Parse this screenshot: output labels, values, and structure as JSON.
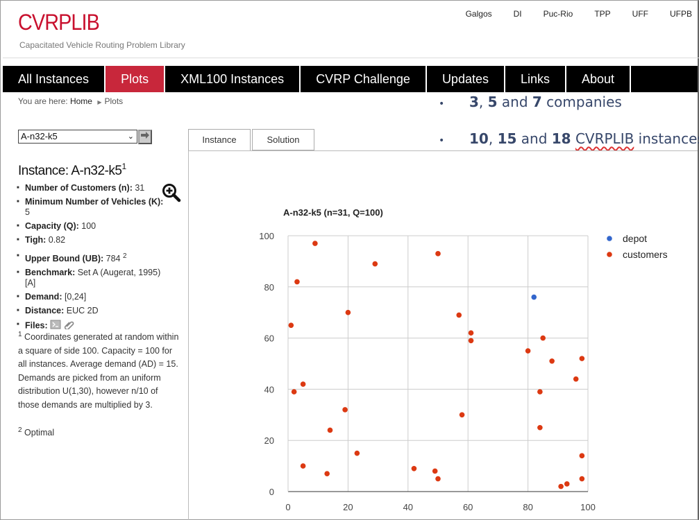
{
  "site": {
    "logo": "CVRPLIB",
    "tagline": "Capacitated Vehicle Routing Problem Library"
  },
  "top_links": [
    "Galgos",
    "DI",
    "Puc-Rio",
    "TPP",
    "UFF",
    "UFPB"
  ],
  "nav": [
    {
      "label": "All Instances",
      "active": false
    },
    {
      "label": "Plots",
      "active": true
    },
    {
      "label": "XML100 Instances",
      "active": false
    },
    {
      "label": "CVRP Challenge",
      "active": false
    },
    {
      "label": "Updates",
      "active": false
    },
    {
      "label": "Links",
      "active": false
    },
    {
      "label": "About",
      "active": false
    }
  ],
  "breadcrumb": {
    "prefix": "You are here:",
    "home": "Home",
    "current": "Plots"
  },
  "overlay": {
    "line1": {
      "n1": "3",
      "sep1": ", ",
      "n2": "5",
      "mid": " and ",
      "n3": "7",
      "tail": " companies"
    },
    "line2": {
      "n1": "10",
      "sep1": ", ",
      "n2": "15",
      "mid": " and ",
      "n3": "18",
      "word": "CVRPLIB",
      "tail": " instances"
    }
  },
  "selector": {
    "value": "A-n32-k5"
  },
  "instance": {
    "title": "Instance: A-n32-k5",
    "title_sup": "1",
    "props": [
      {
        "label": "Number of Customers (n):",
        "value": " 31"
      },
      {
        "label": "Minimum Number of Vehicles (K):",
        "value": " 5"
      },
      {
        "label": "Capacity (Q):",
        "value": " 100"
      },
      {
        "label": "Tigh:",
        "value": " 0.82"
      },
      {
        "label": "Upper Bound (UB):",
        "value": " 784",
        "sup": "2"
      },
      {
        "label": "Benchmark:",
        "value": " Set A (Augerat, 1995) [A]"
      },
      {
        "label": "Demand:",
        "value": " [0,24]"
      },
      {
        "label": "Distance:",
        "value": " EUC 2D"
      },
      {
        "label": "Files:",
        "value": ""
      }
    ]
  },
  "notes": {
    "n1_sup": "1",
    "n1": " Coordinates generated at random within a square of side 100. Capacity = 100 for all instances. Average demand (AD) = 15. Demands are picked from an uniform distribution U(1,30), however n/10 of those demands are multiplied by 3.",
    "n2_sup": "2",
    "n2": " Optimal"
  },
  "tabs": [
    "Instance",
    "Solution"
  ],
  "colors": {
    "brand": "#c8102e",
    "depot": "#3366cc",
    "customers": "#dc3912"
  },
  "chart_data": {
    "type": "scatter",
    "title": "A-n32-k5 (n=31, Q=100)",
    "xlabel": "",
    "ylabel": "",
    "xlim": [
      0,
      100
    ],
    "ylim": [
      0,
      100
    ],
    "xticks": [
      0,
      20,
      40,
      60,
      80,
      100
    ],
    "yticks": [
      0,
      20,
      40,
      60,
      80,
      100
    ],
    "grid": true,
    "legend": "right",
    "series": [
      {
        "name": "depot",
        "color": "#3366cc",
        "points": [
          [
            82,
            76
          ]
        ]
      },
      {
        "name": "customers",
        "color": "#dc3912",
        "points": [
          [
            96,
            44
          ],
          [
            50,
            5
          ],
          [
            49,
            8
          ],
          [
            13,
            7
          ],
          [
            29,
            89
          ],
          [
            58,
            30
          ],
          [
            84,
            39
          ],
          [
            14,
            24
          ],
          [
            2,
            39
          ],
          [
            3,
            82
          ],
          [
            5,
            10
          ],
          [
            98,
            52
          ],
          [
            84,
            25
          ],
          [
            61,
            59
          ],
          [
            1,
            65
          ],
          [
            88,
            51
          ],
          [
            91,
            2
          ],
          [
            19,
            32
          ],
          [
            93,
            3
          ],
          [
            50,
            93
          ],
          [
            98,
            14
          ],
          [
            5,
            42
          ],
          [
            42,
            9
          ],
          [
            61,
            62
          ],
          [
            9,
            97
          ],
          [
            80,
            55
          ],
          [
            57,
            69
          ],
          [
            23,
            15
          ],
          [
            20,
            70
          ],
          [
            85,
            60
          ],
          [
            98,
            5
          ]
        ]
      }
    ]
  }
}
